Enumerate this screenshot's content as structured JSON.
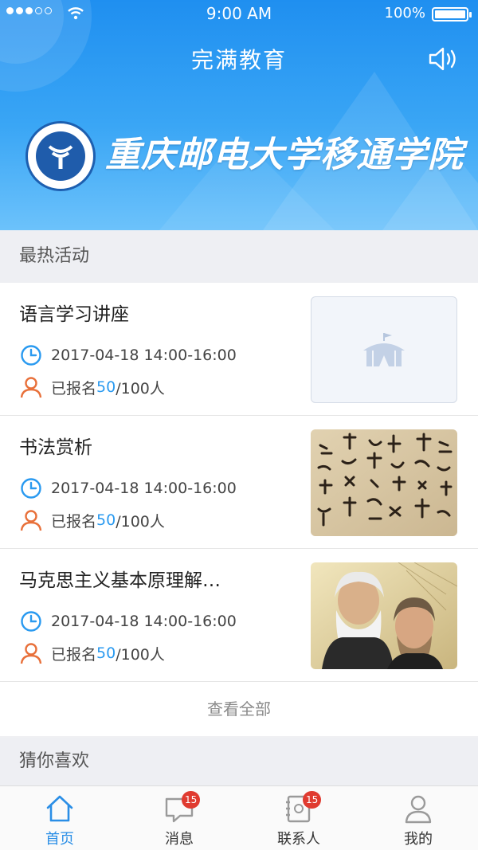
{
  "status_bar": {
    "time": "9:00 AM",
    "battery": "100%"
  },
  "header": {
    "title": "完满教育",
    "speaker_icon": "speaker-icon"
  },
  "banner": {
    "school_name": "重庆邮电大学移通学院",
    "logo_icon": "university-emblem"
  },
  "hot_section": {
    "title": "最热活动",
    "items": [
      {
        "title": "语言学习讲座",
        "time": "2017-04-18 14:00-16:00",
        "enroll_prefix": "已报名",
        "enrolled": "50",
        "enroll_suffix": "/100人",
        "thumb": "placeholder-tent"
      },
      {
        "title": "书法赏析",
        "time": "2017-04-18 14:00-16:00",
        "enroll_prefix": "已报名",
        "enrolled": "50",
        "enroll_suffix": "/100人",
        "thumb": "calligraphy"
      },
      {
        "title": "马克思主义基本原理解…",
        "time": "2017-04-18 14:00-16:00",
        "enroll_prefix": "已报名",
        "enrolled": "50",
        "enroll_suffix": "/100人",
        "thumb": "portrait"
      }
    ],
    "view_all": "查看全部"
  },
  "like_section": {
    "title": "猜你喜欢"
  },
  "tabbar": {
    "tabs": [
      {
        "label": "首页",
        "icon": "home-icon",
        "active": true
      },
      {
        "label": "消息",
        "icon": "message-icon",
        "badge": "15"
      },
      {
        "label": "联系人",
        "icon": "contacts-icon",
        "badge": "15"
      },
      {
        "label": "我的",
        "icon": "profile-icon"
      }
    ]
  },
  "colors": {
    "accent": "#2a9af0",
    "header_top": "#1f8ff0",
    "badge": "#e03b30",
    "user_icon": "#e8703a"
  }
}
